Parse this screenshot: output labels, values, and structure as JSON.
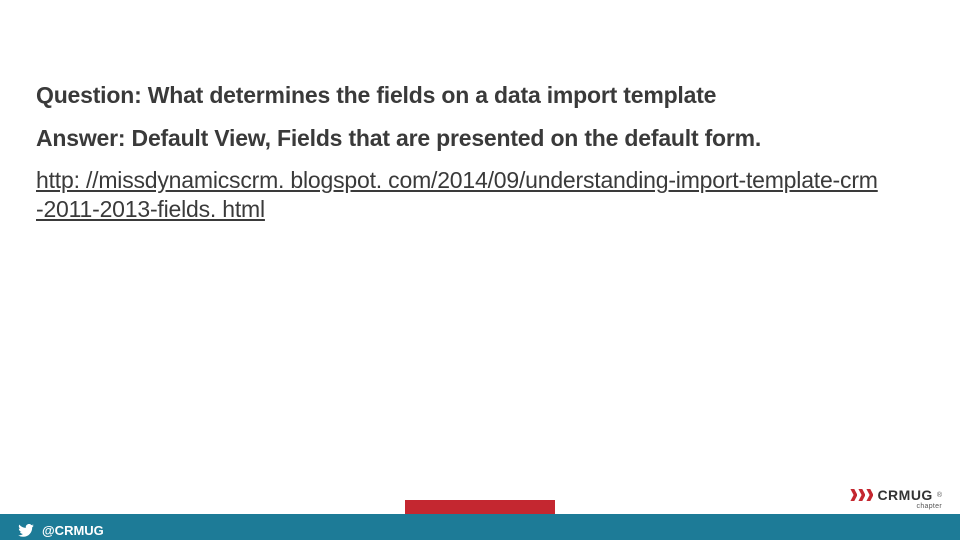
{
  "question": {
    "label": "Question:",
    "text": " What determines the fields on a data import template"
  },
  "answer": {
    "label": "Answer:",
    "text": " Default View, Fields that are presented on the default form."
  },
  "link": {
    "line1": "http: //missdynamicscrm. blogspot. com/2014/09/understanding-import-template-crm",
    "line2": "-2011-2013-fields. html"
  },
  "footer": {
    "handle": "@CRMUG"
  },
  "logo": {
    "brand": "CRMUG",
    "reg": "®",
    "sub": "chapter"
  }
}
